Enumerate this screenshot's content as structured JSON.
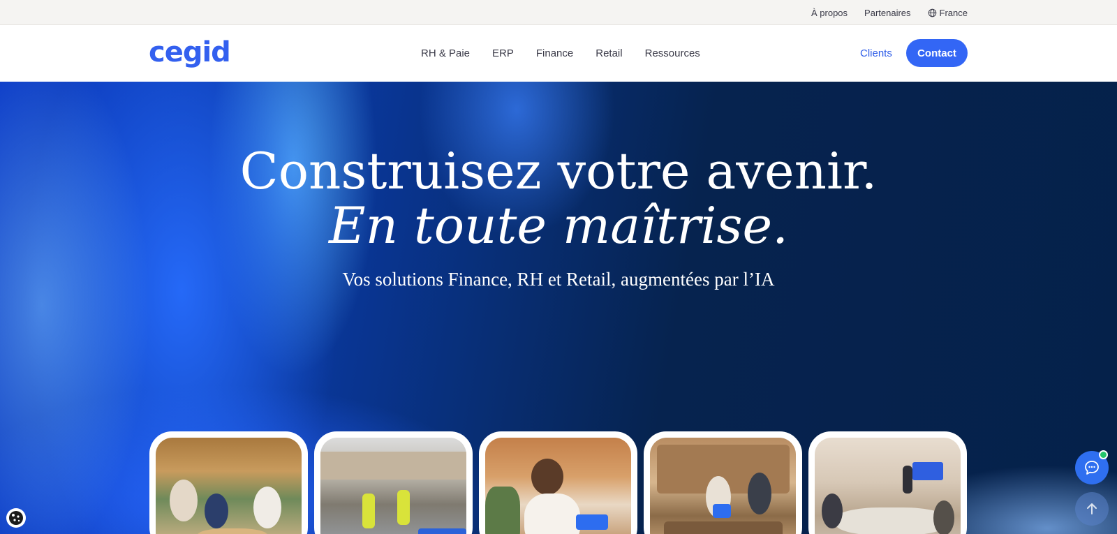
{
  "utility_bar": {
    "about": "À propos",
    "partners": "Partenaires",
    "country": "France",
    "country_icon": "globe-icon"
  },
  "header": {
    "logo": "cegid",
    "nav": [
      "RH & Paie",
      "ERP",
      "Finance",
      "Retail",
      "Ressources"
    ],
    "clients": "Clients",
    "contact": "Contact"
  },
  "hero": {
    "title": "Construisez votre avenir.",
    "title_italic": "En toute maîtrise.",
    "subtitle": "Vos solutions Finance, RH et Retail, augmentées par l’IA"
  },
  "cards": [
    {
      "scene": "team-meeting-cafe"
    },
    {
      "scene": "warehouse-workers"
    },
    {
      "scene": "woman-with-tablet"
    },
    {
      "scene": "retail-store-checkout"
    },
    {
      "scene": "boardroom-presentation"
    }
  ],
  "floating": {
    "cookie_icon": "cookie-icon",
    "chat_icon": "chat-icon",
    "scroll_icon": "arrow-up-icon"
  },
  "colors": {
    "brand_blue": "#3360ef",
    "contact_button": "#3366f5",
    "hero_dark": "#05214a",
    "online": "#24c46b"
  }
}
